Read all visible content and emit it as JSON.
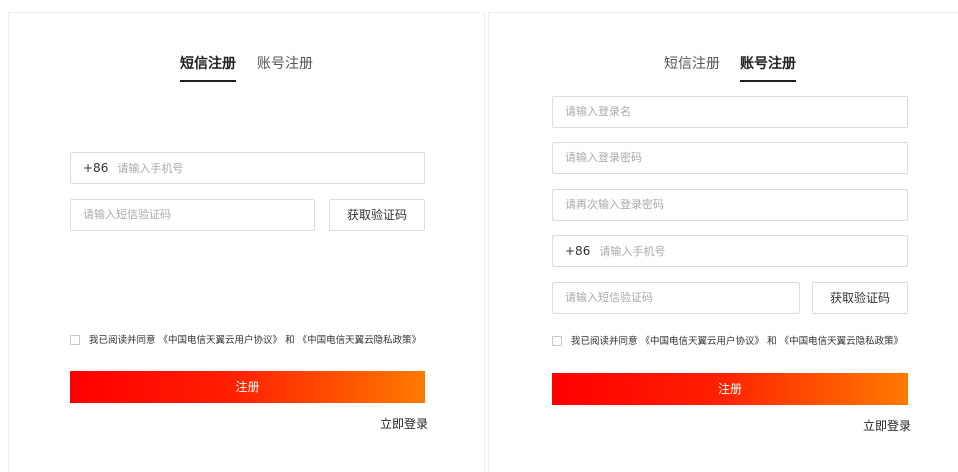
{
  "sms_panel": {
    "tabs": [
      {
        "label": "短信注册",
        "active": true
      },
      {
        "label": "账号注册",
        "active": false
      }
    ],
    "phone_prefix": "+86",
    "phone_placeholder": "请输入手机号",
    "sms_code_placeholder": "请输入短信验证码",
    "get_code_label": "获取验证码",
    "agreement": {
      "prefix": "我已阅读并同意",
      "user_agreement": "《中国电信天翼云用户协议》",
      "and": "和",
      "privacy_policy": "《中国电信天翼云隐私政策》"
    },
    "register_label": "注册",
    "login_link": "立即登录"
  },
  "account_panel": {
    "tabs": [
      {
        "label": "短信注册",
        "active": false
      },
      {
        "label": "账号注册",
        "active": true
      }
    ],
    "username_placeholder": "请输入登录名",
    "password_placeholder": "请输入登录密码",
    "password_confirm_placeholder": "请再次输入登录密码",
    "phone_prefix": "+86",
    "phone_placeholder": "请输入手机号",
    "sms_code_placeholder": "请输入短信验证码",
    "get_code_label": "获取验证码",
    "agreement": {
      "prefix": "我已阅读并同意",
      "user_agreement": "《中国电信天翼云用户协议》",
      "and": "和",
      "privacy_policy": "《中国电信天翼云隐私政策》"
    },
    "register_label": "注册",
    "login_link": "立即登录"
  },
  "colors": {
    "gradient_start": "#ff0000",
    "gradient_end": "#ff7a00",
    "border": "#dcdcdc"
  }
}
